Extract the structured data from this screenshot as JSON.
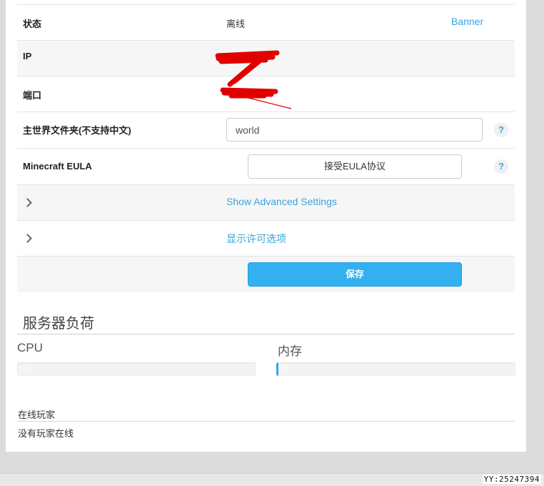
{
  "settings": {
    "status_label": "状态",
    "status_value": "离线",
    "banner_link": "Banner",
    "ip_label": "IP",
    "port_label": "端口",
    "world_folder_label": "主世界文件夹(不支持中文)",
    "world_folder_value": "world",
    "eula_label": "Minecraft EULA",
    "eula_button": "接受EULA协议",
    "help_glyph": "?",
    "advanced_toggle": "Show Advanced Settings",
    "permissions_toggle": "显示许可选项",
    "save_button": "保存"
  },
  "server_load": {
    "title": "服务器负荷",
    "cpu_label": "CPU",
    "cpu_percent": 0,
    "cpu_text": "0%",
    "memory_label": "内存",
    "memory_percent": 1,
    "memory_text": "1%"
  },
  "players": {
    "title": "在线玩家",
    "empty_text": "没有玩家在线"
  },
  "footer": {
    "watermark": "YY:25247394"
  },
  "colors": {
    "accent": "#32b0f0",
    "link": "#3aa3dc",
    "redaction": "#e00000"
  }
}
